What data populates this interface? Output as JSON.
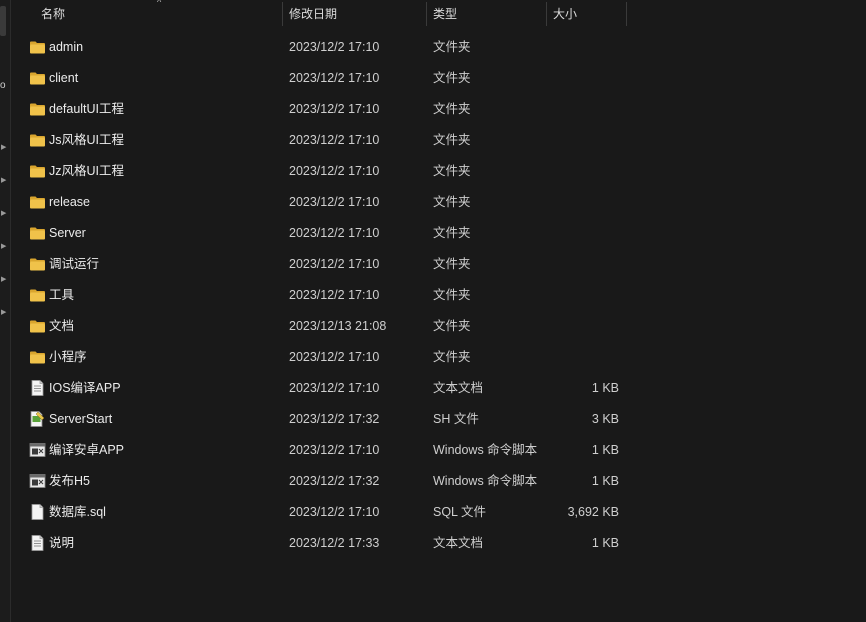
{
  "header": {
    "name": "名称",
    "date": "修改日期",
    "type": "类型",
    "size": "大小",
    "sort_indicator": "^"
  },
  "nav": {
    "letter": "o"
  },
  "files": [
    {
      "name": "admin",
      "date": "2023/12/2 17:10",
      "type": "文件夹",
      "size": "",
      "icon": "folder-icon"
    },
    {
      "name": "client",
      "date": "2023/12/2 17:10",
      "type": "文件夹",
      "size": "",
      "icon": "folder-icon"
    },
    {
      "name": "defaultUI工程",
      "date": "2023/12/2 17:10",
      "type": "文件夹",
      "size": "",
      "icon": "folder-icon"
    },
    {
      "name": "Js风格UI工程",
      "date": "2023/12/2 17:10",
      "type": "文件夹",
      "size": "",
      "icon": "folder-icon"
    },
    {
      "name": "Jz风格UI工程",
      "date": "2023/12/2 17:10",
      "type": "文件夹",
      "size": "",
      "icon": "folder-icon"
    },
    {
      "name": "release",
      "date": "2023/12/2 17:10",
      "type": "文件夹",
      "size": "",
      "icon": "folder-icon"
    },
    {
      "name": "Server",
      "date": "2023/12/2 17:10",
      "type": "文件夹",
      "size": "",
      "icon": "folder-icon"
    },
    {
      "name": "调试运行",
      "date": "2023/12/2 17:10",
      "type": "文件夹",
      "size": "",
      "icon": "folder-icon"
    },
    {
      "name": "工具",
      "date": "2023/12/2 17:10",
      "type": "文件夹",
      "size": "",
      "icon": "folder-icon"
    },
    {
      "name": "文档",
      "date": "2023/12/13 21:08",
      "type": "文件夹",
      "size": "",
      "icon": "folder-icon"
    },
    {
      "name": "小程序",
      "date": "2023/12/2 17:10",
      "type": "文件夹",
      "size": "",
      "icon": "folder-icon"
    },
    {
      "name": "IOS编译APP",
      "date": "2023/12/2 17:10",
      "type": "文本文档",
      "size": "1 KB",
      "icon": "text-file-icon"
    },
    {
      "name": "ServerStart",
      "date": "2023/12/2 17:32",
      "type": "SH 文件",
      "size": "3 KB",
      "icon": "script-file-icon"
    },
    {
      "name": "编译安卓APP",
      "date": "2023/12/2 17:10",
      "type": "Windows 命令脚本",
      "size": "1 KB",
      "icon": "batch-file-icon"
    },
    {
      "name": "发布H5",
      "date": "2023/12/2 17:32",
      "type": "Windows 命令脚本",
      "size": "1 KB",
      "icon": "batch-file-icon"
    },
    {
      "name": "数据库.sql",
      "date": "2023/12/2 17:10",
      "type": "SQL 文件",
      "size": "3,692 KB",
      "icon": "blank-file-icon"
    },
    {
      "name": "说明",
      "date": "2023/12/2 17:33",
      "type": "文本文档",
      "size": "1 KB",
      "icon": "text-file-icon"
    }
  ],
  "colors": {
    "background": "#191919",
    "folder": "#f0c24a",
    "folder_dark": "#d9a52e"
  }
}
